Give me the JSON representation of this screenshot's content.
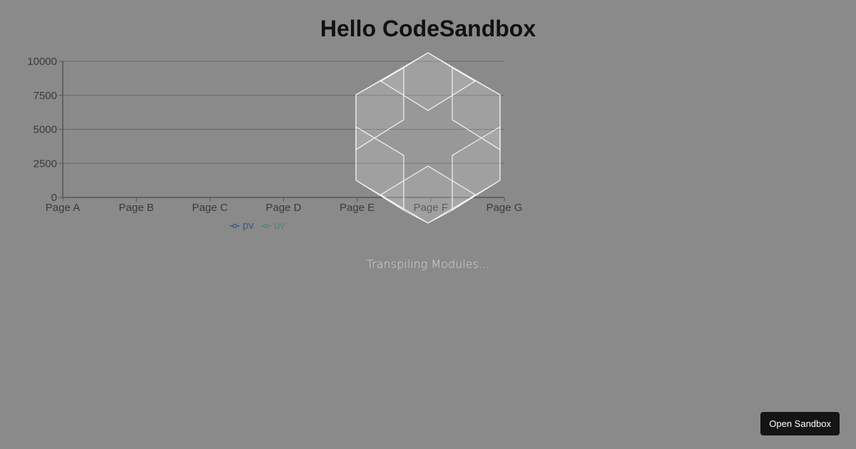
{
  "header": {
    "title": "Hello CodeSandbox"
  },
  "chart_data": {
    "type": "line",
    "categories": [
      "Page A",
      "Page B",
      "Page C",
      "Page D",
      "Page E",
      "Page F",
      "Page G"
    ],
    "yticks": [
      "0",
      "2500",
      "5000",
      "7500",
      "10000"
    ],
    "ylim": [
      0,
      10000
    ],
    "series": [
      {
        "name": "pv",
        "color": "#3f5a8a",
        "values": []
      },
      {
        "name": "uv",
        "color": "#4f8a6a",
        "values": []
      }
    ],
    "grid": true,
    "legend": "bottom"
  },
  "loading": {
    "text": "Transpiling Modules..."
  },
  "footer": {
    "open_sandbox": "Open Sandbox"
  }
}
